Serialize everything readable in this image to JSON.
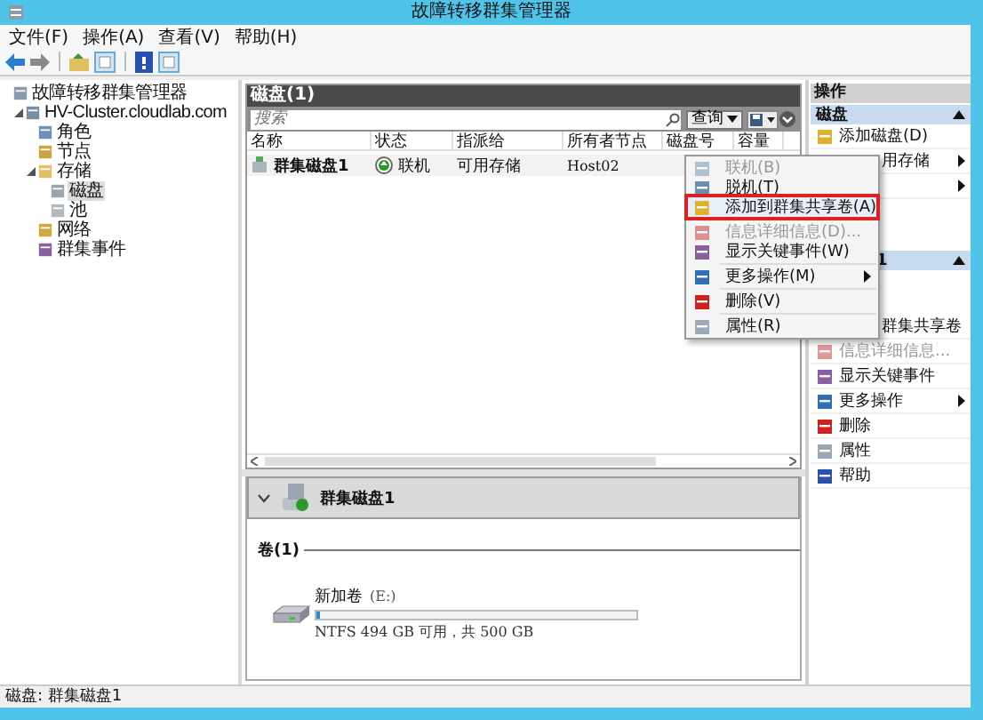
{
  "window": {
    "title": "故障转移群集管理器"
  },
  "menu": [
    "文件(F)",
    "操作(A)",
    "查看(V)",
    "帮助(H)"
  ],
  "tree": [
    {
      "label": "故障转移群集管理器",
      "selected": false,
      "children": [
        {
          "label": "HV-Cluster.cloudlab.com",
          "expanded": true,
          "selected": false,
          "children": [
            {
              "label": "角色",
              "selected": false
            },
            {
              "label": "节点",
              "selected": false
            },
            {
              "label": "存储",
              "expanded": true,
              "selected": false,
              "children": [
                {
                  "label": "磁盘",
                  "selected": true
                },
                {
                  "label": "池",
                  "selected": false
                }
              ]
            },
            {
              "label": "网络",
              "selected": false
            },
            {
              "label": "群集事件",
              "selected": false
            }
          ]
        }
      ]
    }
  ],
  "center": {
    "title": "磁盘(1)",
    "search": {
      "placeholder": "搜索"
    },
    "query_button": "查询",
    "columns": [
      "名称",
      "状态",
      "指派给",
      "所有者节点",
      "磁盘号",
      "容量"
    ],
    "rows": [
      {
        "name": "群集磁盘1",
        "status": "联机",
        "online": true,
        "assigned": "可用存储",
        "owner": "Host02"
      }
    ]
  },
  "detail": {
    "title": "群集磁盘1",
    "expanded": true,
    "volumes_label": "卷(1)",
    "volumes": [
      {
        "name": "新加卷",
        "drive": "(E:)",
        "level": 0.012,
        "info": "NTFS 494 GB 可用，共 500 GB"
      }
    ]
  },
  "context_menu": [
    {
      "kind": "item",
      "label": "联机(B)",
      "disabled": true,
      "highlighted": false
    },
    {
      "kind": "item",
      "label": "脱机(T)",
      "disabled": false,
      "highlighted": false
    },
    {
      "kind": "item",
      "label": "添加到群集共享卷(A)",
      "disabled": false,
      "highlighted": true
    },
    {
      "kind": "separator"
    },
    {
      "kind": "item",
      "label": "信息详细信息(D)...",
      "disabled": true,
      "highlighted": false
    },
    {
      "kind": "item",
      "label": "显示关键事件(W)",
      "disabled": false,
      "highlighted": false
    },
    {
      "kind": "separator"
    },
    {
      "kind": "item",
      "label": "更多操作(M)",
      "disabled": false,
      "highlighted": false,
      "submenu": true
    },
    {
      "kind": "separator"
    },
    {
      "kind": "item",
      "label": "删除(V)",
      "disabled": false,
      "highlighted": false
    },
    {
      "kind": "separator"
    },
    {
      "kind": "item",
      "label": "属性(R)",
      "disabled": false,
      "highlighted": false
    }
  ],
  "actions": {
    "title": "操作",
    "sections": [
      {
        "title": "磁盘",
        "covered": false,
        "expanded": true,
        "items": [
          {
            "label": "添加磁盘(D)",
            "covered": false,
            "disabled": false
          },
          {
            "label": "用存储",
            "covered": true,
            "submenu": true,
            "disabled": false
          },
          {
            "covered": true,
            "submenu": true,
            "disabled": false
          }
        ]
      },
      {
        "title": "1",
        "covered": true,
        "expanded": true,
        "items": [
          {
            "label": "群集共享卷",
            "covered": true,
            "disabled": false
          },
          {
            "label": "信息详细信息...",
            "covered": false,
            "disabled": true
          },
          {
            "label": "显示关键事件",
            "covered": false,
            "disabled": false
          },
          {
            "label": "更多操作",
            "covered": false,
            "submenu": true,
            "disabled": false
          },
          {
            "label": "删除",
            "covered": false,
            "disabled": false
          },
          {
            "label": "属性",
            "covered": false,
            "disabled": false
          },
          {
            "label": "帮助",
            "covered": false,
            "disabled": false
          }
        ]
      }
    ]
  },
  "status_bar": "磁盘: 群集磁盘1"
}
